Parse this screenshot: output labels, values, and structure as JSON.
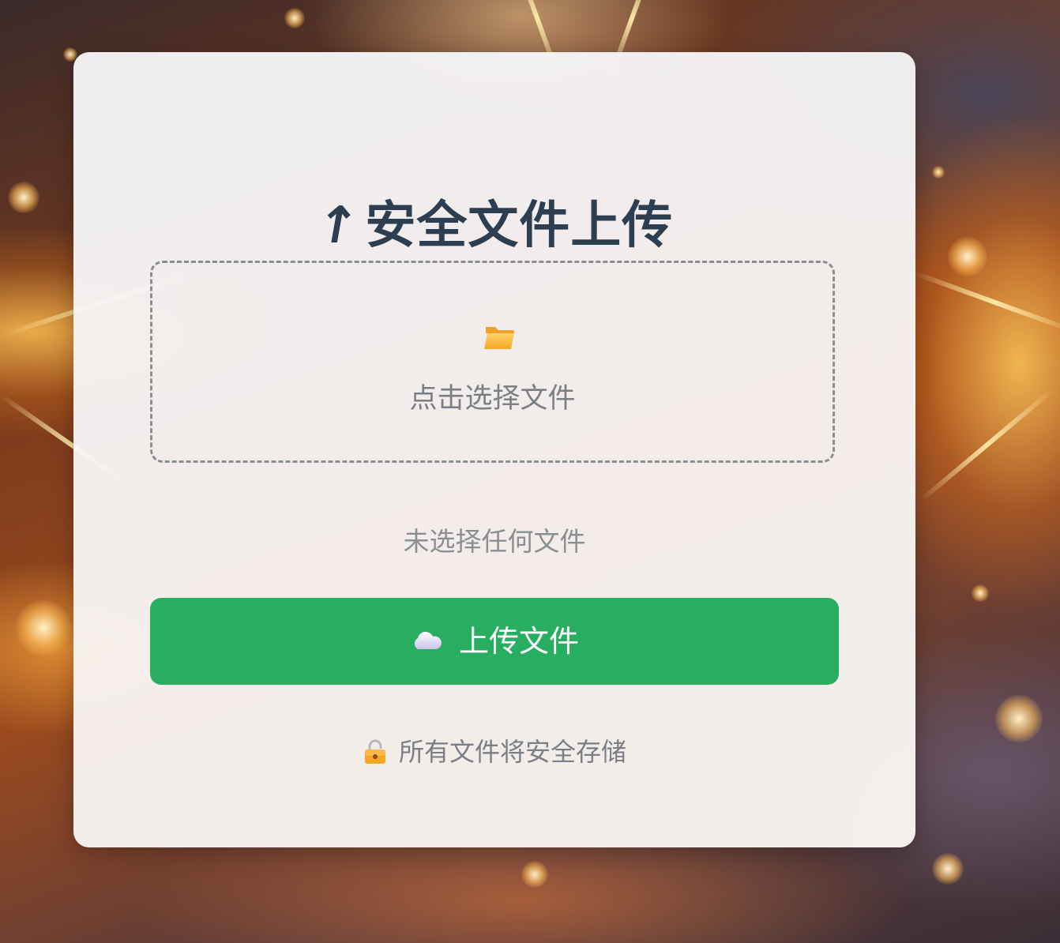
{
  "header": {
    "title_icon": "↑",
    "title": "安全文件上传"
  },
  "dropzone": {
    "icon": "folder-icon",
    "label": "点击选择文件"
  },
  "file_status": "未选择任何文件",
  "upload_button": {
    "icon": "cloud-icon",
    "label": "上传文件"
  },
  "footer": {
    "icon": "lock-icon",
    "note": "所有文件将安全存储"
  },
  "colors": {
    "title": "#2c3e50",
    "button": "#27ae60",
    "muted_text": "#7a7f85",
    "dashed_border": "#8a8f94"
  }
}
